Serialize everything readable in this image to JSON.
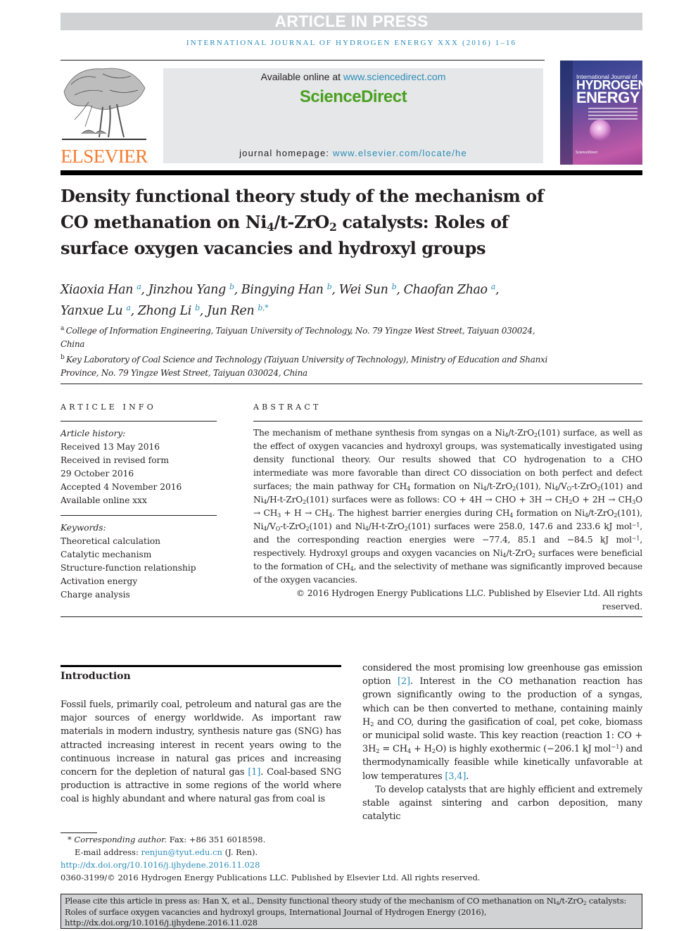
{
  "banner": "ARTICLE IN PRESS",
  "running_head": "INTERNATIONAL JOURNAL OF HYDROGEN ENERGY XXX (2016) 1–16",
  "publisher": {
    "logo_text": "ELSEVIER",
    "logo_icon": "elsevier-tree-icon"
  },
  "sciencedirect": {
    "available_prefix": "Available online at ",
    "available_link": "www.sciencedirect.com",
    "logo": "ScienceDirect",
    "homepage_prefix": "journal homepage: ",
    "homepage_link": "www.elsevier.com/locate/he"
  },
  "cover": {
    "line1": "International Journal of",
    "line2": "HYDROGEN",
    "line3": "ENERGY",
    "foot": "ScienceDirect"
  },
  "colors": {
    "link": "#2a8cb8",
    "elsevier_orange": "#f47d30",
    "sciencedirect_green": "#4aa020",
    "banner_gray": "#d1d2d4"
  },
  "article": {
    "title_part1": "Density functional theory study of the mechanism of CO methanation on Ni",
    "title_sub1": "4",
    "title_part2": "/t-ZrO",
    "title_sub2": "2",
    "title_part3": " catalysts: Roles of surface oxygen vacancies and hydroxyl groups",
    "authors": [
      {
        "name": "Xiaoxia Han",
        "aff": "a"
      },
      {
        "name": "Jinzhou Yang",
        "aff": "b"
      },
      {
        "name": "Bingying Han",
        "aff": "b"
      },
      {
        "name": "Wei Sun",
        "aff": "b"
      },
      {
        "name": "Chaofan Zhao",
        "aff": "a"
      },
      {
        "name": "Yanxue Lu",
        "aff": "a"
      },
      {
        "name": "Zhong Li",
        "aff": "b"
      },
      {
        "name": "Jun Ren",
        "aff": "b,*"
      }
    ],
    "affiliations": [
      {
        "letter": "a",
        "text": "College of Information Engineering, Taiyuan University of Technology, No. 79 Yingze West Street, Taiyuan 030024, China"
      },
      {
        "letter": "b",
        "text": "Key Laboratory of Coal Science and Technology (Taiyuan University of Technology), Ministry of Education and Shanxi Province, No. 79 Yingze West Street, Taiyuan 030024, China"
      }
    ]
  },
  "article_info": {
    "heading": "ARTICLE INFO",
    "history_label": "Article history:",
    "history": [
      "Received 13 May 2016",
      "Received in revised form",
      "29 October 2016",
      "Accepted 4 November 2016",
      "Available online xxx"
    ],
    "keywords_label": "Keywords:",
    "keywords": [
      "Theoretical calculation",
      "Catalytic mechanism",
      "Structure-function relationship",
      "Activation energy",
      "Charge analysis"
    ]
  },
  "abstract": {
    "heading": "ABSTRACT",
    "copyright": "© 2016 Hydrogen Energy Publications LLC. Published by Elsevier Ltd. All rights reserved."
  },
  "introduction": {
    "heading": "Introduction",
    "refs": [
      "[1]",
      "[2]",
      "[3,4]"
    ]
  },
  "footnotes": {
    "corresponding": "Corresponding author.",
    "fax": " Fax: +86 351 6018598.",
    "email_label": "E-mail address: ",
    "email": "renjun@tyut.edu.cn",
    "email_suffix": " (J. Ren).",
    "doi": "http://dx.doi.org/10.1016/j.ijhydene.2016.11.028",
    "issn_line": "0360-3199/© 2016 Hydrogen Energy Publications LLC. Published by Elsevier Ltd. All rights reserved."
  },
  "citation_box": {
    "prefix": "Please cite this article in press as: Han X, et al., Density functional theory study of the mechanism of CO methanation on Ni",
    "mid": "/t-ZrO",
    "suffix": " catalysts: Roles of surface oxygen vacancies and hydroxyl groups, International Journal of Hydrogen Energy (2016), http://dx.doi.org/10.1016/j.ijhydene.2016.11.028"
  }
}
